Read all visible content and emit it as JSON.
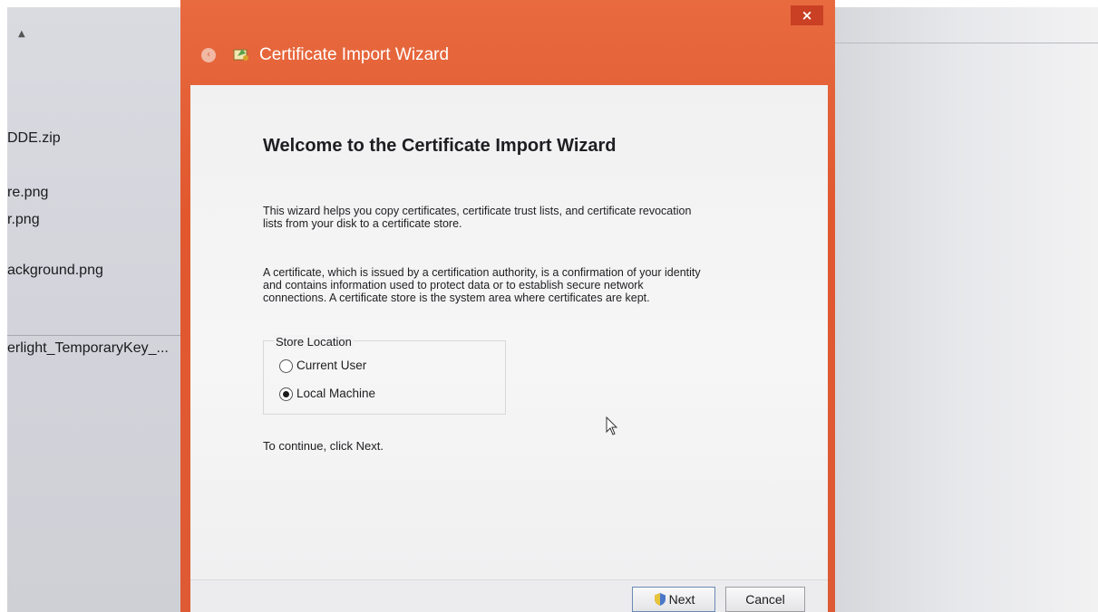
{
  "background_files": [
    "DDE.zip",
    "re.png",
    "r.png",
    "ackground.png",
    "erlight_TemporaryKey_..."
  ],
  "window": {
    "title": "Certificate Import Wizard",
    "close_glyph": "×",
    "back_glyph": "‹"
  },
  "wizard": {
    "heading": "Welcome to the Certificate Import Wizard",
    "para1_line1": "This wizard helps you copy certificates, certificate trust lists, and certificate revocation",
    "para1_line2": "lists from your disk to a certificate store.",
    "para2_line1": "A certificate, which is issued by a certification authority, is a confirmation of your identity",
    "para2_line2": "and contains information used to protect data or to establish secure network",
    "para2_line3": "connections. A certificate store is the system area where certificates are kept.",
    "store_location": {
      "label": "Store Location",
      "options": [
        {
          "label": "Current User",
          "selected": false
        },
        {
          "label": "Local Machine",
          "selected": true
        }
      ]
    },
    "continue_text": "To continue, click Next."
  },
  "buttons": {
    "next_label": "Next",
    "cancel_label": "Cancel"
  },
  "colors": {
    "window_frame": "#e1582f",
    "content_bg": "#f4f4f5"
  }
}
